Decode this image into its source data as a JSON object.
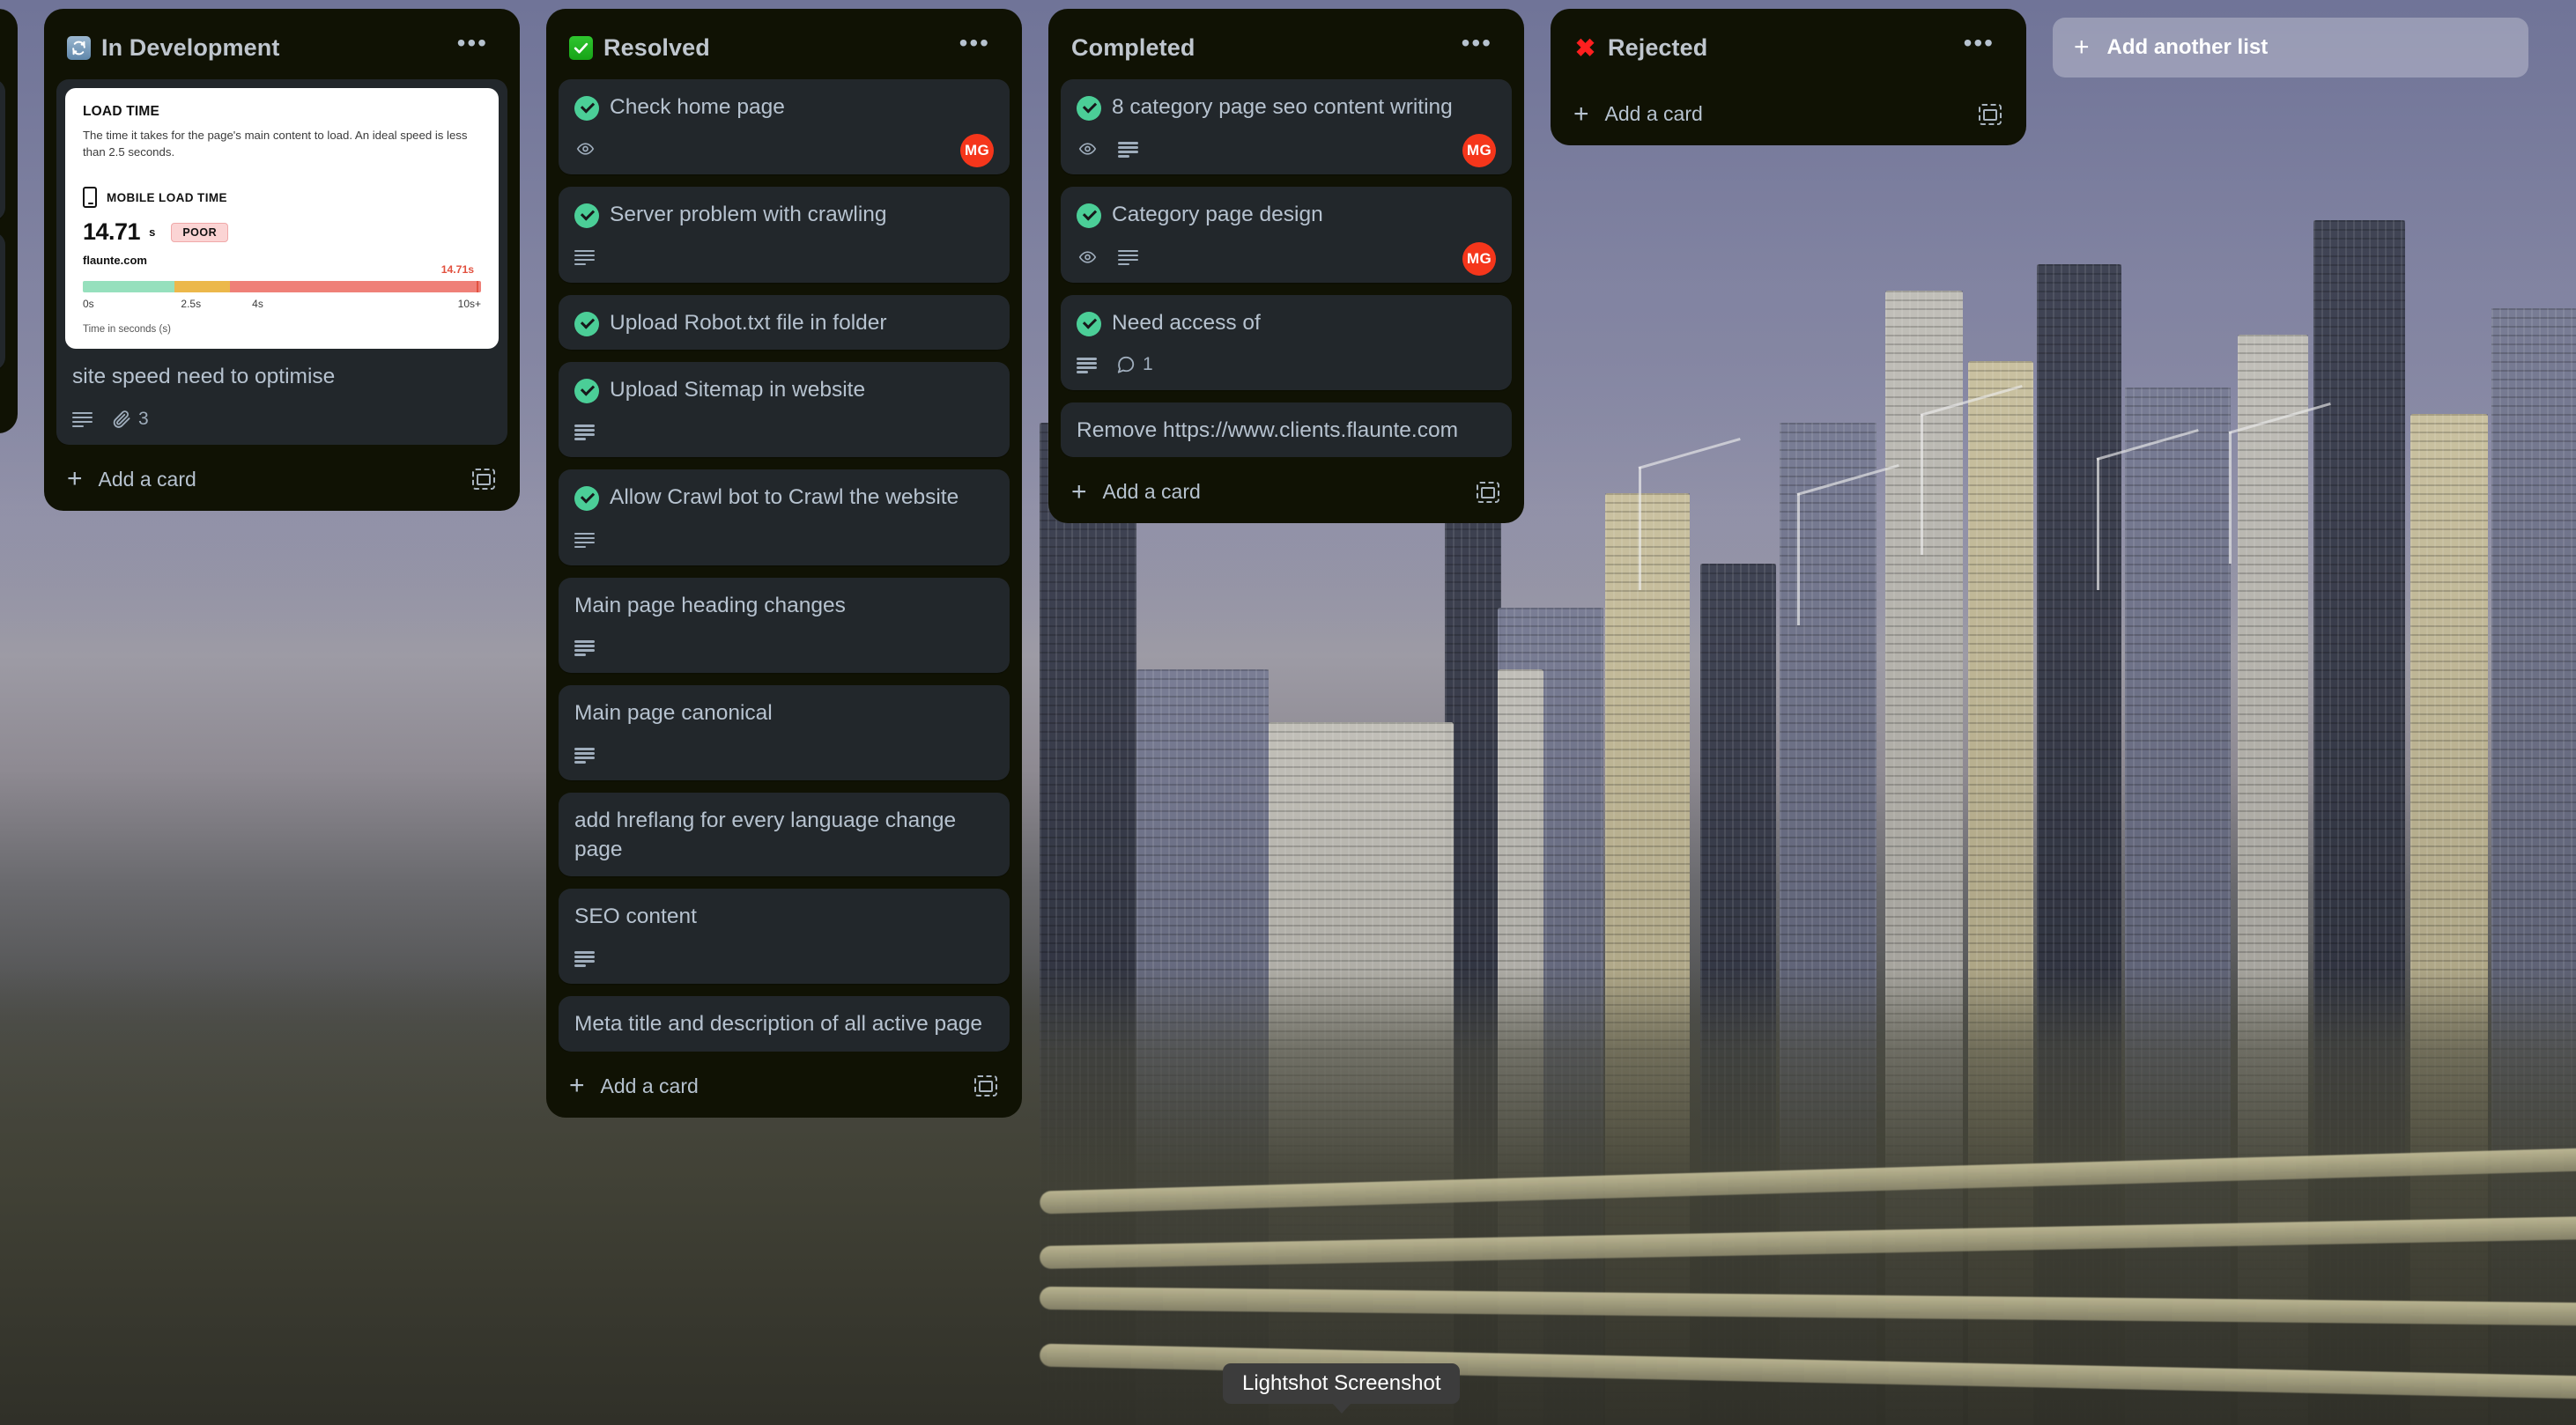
{
  "lists": [
    {
      "id": "partial",
      "title": "",
      "emoji": "",
      "emoji_kind": "none",
      "menu": "•••",
      "add_card_label": "",
      "cards": []
    },
    {
      "id": "in-development",
      "title": "In Development",
      "emoji": "🔄",
      "emoji_kind": "sync",
      "menu": "•••",
      "add_card_label": "Add a card",
      "cards": [
        {
          "title": "site speed need to optimise",
          "done": false,
          "desc": true,
          "watch": false,
          "attachments": "3",
          "comments": null,
          "avatar": null,
          "cover": {
            "heading": "LOAD TIME",
            "description": "The time it takes for the page's main content to load. An ideal speed is less than 2.5 seconds.",
            "metric_label": "MOBILE LOAD TIME",
            "value": "14.71",
            "unit": "s",
            "rating": "POOR",
            "domain": "flaunte.com",
            "marker_label": "14.71s",
            "scale": [
              "0s",
              "2.5s",
              "4s",
              "10s+"
            ],
            "axis_caption": "Time in seconds (s)"
          }
        }
      ]
    },
    {
      "id": "resolved",
      "title": "Resolved",
      "emoji": "✅",
      "emoji_kind": "check",
      "menu": "•••",
      "add_card_label": "Add a card",
      "cards": [
        {
          "title": "Check home page",
          "done": true,
          "desc": false,
          "watch": true,
          "attachments": null,
          "comments": null,
          "avatar": "MG"
        },
        {
          "title": "Server problem with crawling",
          "done": true,
          "desc": true,
          "watch": false,
          "attachments": null,
          "comments": null,
          "avatar": null
        },
        {
          "title": "Upload Robot.txt file in folder",
          "done": true,
          "desc": false,
          "watch": false,
          "attachments": null,
          "comments": null,
          "avatar": null
        },
        {
          "title": "Upload Sitemap in website",
          "done": true,
          "desc": true,
          "watch": false,
          "attachments": null,
          "comments": null,
          "avatar": null
        },
        {
          "title": "Allow Crawl bot to Crawl the website",
          "done": true,
          "desc": true,
          "watch": false,
          "attachments": null,
          "comments": null,
          "avatar": null
        },
        {
          "title": "Main page heading changes",
          "done": false,
          "desc": true,
          "watch": false,
          "attachments": null,
          "comments": null,
          "avatar": null
        },
        {
          "title": "Main page canonical",
          "done": false,
          "desc": true,
          "watch": false,
          "attachments": null,
          "comments": null,
          "avatar": null
        },
        {
          "title": "add hreflang for every language change page",
          "done": false,
          "desc": false,
          "watch": false,
          "attachments": null,
          "comments": null,
          "avatar": null
        },
        {
          "title": "SEO content",
          "done": false,
          "desc": true,
          "watch": false,
          "attachments": null,
          "comments": null,
          "avatar": null
        },
        {
          "title": "Meta title and description of all active page",
          "done": false,
          "desc": false,
          "watch": false,
          "attachments": null,
          "comments": null,
          "avatar": null
        }
      ]
    },
    {
      "id": "completed",
      "title": "Completed",
      "emoji": "",
      "emoji_kind": "none",
      "menu": "•••",
      "add_card_label": "Add a card",
      "cards": [
        {
          "title": "8 category page seo content writing",
          "done": true,
          "desc": true,
          "watch": true,
          "attachments": null,
          "comments": null,
          "avatar": "MG"
        },
        {
          "title": "Category page design",
          "done": true,
          "desc": true,
          "watch": true,
          "attachments": null,
          "comments": null,
          "avatar": "MG"
        },
        {
          "title": "Need access of",
          "done": true,
          "desc": true,
          "watch": false,
          "attachments": null,
          "comments": "1",
          "avatar": null
        },
        {
          "title": "Remove https://www.clients.flaunte.com",
          "done": false,
          "desc": false,
          "watch": false,
          "attachments": null,
          "comments": null,
          "avatar": null
        }
      ]
    },
    {
      "id": "rejected",
      "title": "Rejected",
      "emoji": "❌",
      "emoji_kind": "cross",
      "menu": "•••",
      "add_card_label": "Add a card",
      "cards": []
    }
  ],
  "add_another_list": {
    "label": "Add another list",
    "plus": "+"
  },
  "tooltip": {
    "label": "Lightshot Screenshot"
  },
  "colors": {
    "list_bg": "#101204",
    "card_bg": "#22272b",
    "text": "#b6c2cf",
    "avatar_bg": "#f5361b",
    "check_green": "#4bce97",
    "rating_poor_bg": "#fbd4d4",
    "gauge_good": "#96e0bd",
    "gauge_avg": "#ecb84b",
    "gauge_poor": "#ef8078",
    "marker_red": "#e2513f"
  }
}
